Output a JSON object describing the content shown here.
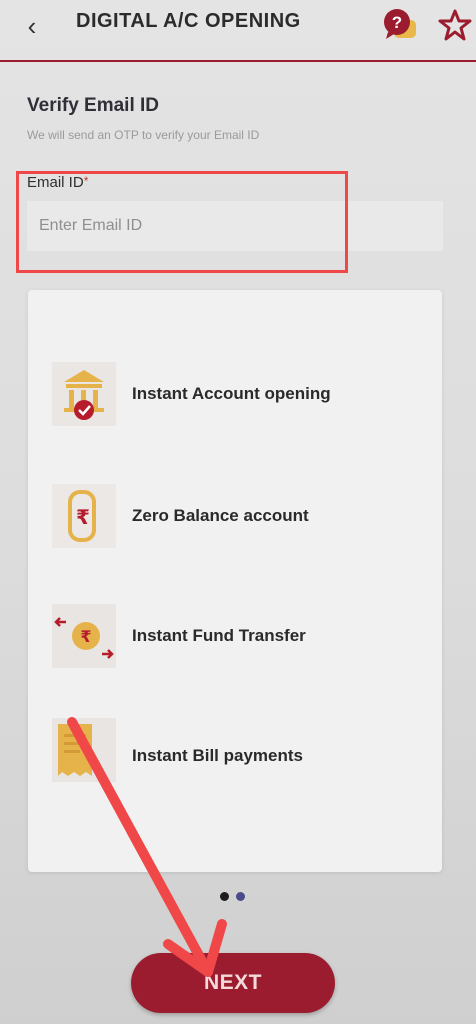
{
  "header": {
    "back_icon": "chevron-left-icon",
    "title": "DIGITAL A/C OPENING",
    "help_icon": "help-chat-icon",
    "favorite_icon": "star-outline-icon",
    "accent_color": "#9b1c2e"
  },
  "verify": {
    "title": "Verify Email ID",
    "subtitle": "We will send an OTP to verify your Email ID",
    "email_label": "Email ID",
    "required_mark": "*",
    "email_placeholder": "Enter Email ID",
    "email_value": ""
  },
  "features": [
    {
      "icon": "bank-check-icon",
      "label": "Instant Account opening"
    },
    {
      "icon": "rupee-wallet-icon",
      "label": "Zero Balance account"
    },
    {
      "icon": "rupee-transfer-icon",
      "label": "Instant Fund Transfer"
    },
    {
      "icon": "bill-icon",
      "label": "Instant Bill payments"
    }
  ],
  "pager": {
    "count": 2,
    "active": 1
  },
  "next_button": {
    "label": "NEXT"
  },
  "annotation": {
    "highlight_color": "#f04848",
    "arrow_color": "#f04848"
  }
}
